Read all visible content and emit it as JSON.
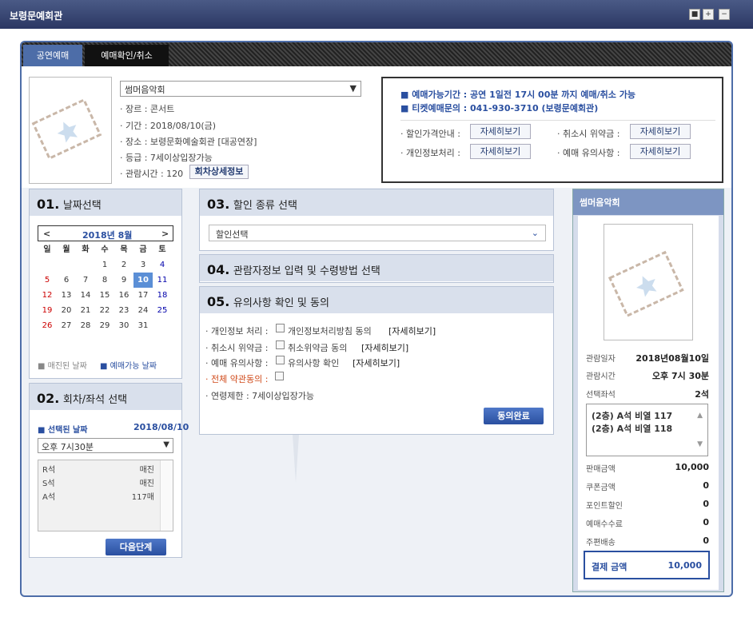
{
  "window": {
    "title": "보령문예회관",
    "buttons": [
      "■",
      "+",
      "−"
    ]
  },
  "tabs": [
    "공연예매",
    "예매확인/취소"
  ],
  "show": {
    "selected": "썸머음악회",
    "genre": "· 장르 : 콘서트",
    "period": "· 기간 : 2018/08/10(금)",
    "venue": "· 장소 : 보령문화예술회관 [대공연장]",
    "grade": "· 등급 : 7세이상입장가능",
    "runtime": "· 관람시간 : 120",
    "detail_btn": "회차상세정보"
  },
  "notice": {
    "line1": "■ 예매가능기간 : 공연 1일전 17시 00분 까지 예매/취소 가능",
    "line2": "■ 티켓예매문의 : 041-930-3710 (보령문예회관)",
    "r1l": "· 할인가격안내 :",
    "r1r": "· 취소시 위약금 :",
    "r2l": "· 개인정보처리 :",
    "r2r": "· 예매 유의사항 :",
    "btn": "자세히보기"
  },
  "p1": {
    "num": "01.",
    "title": "날짜선택",
    "month": "2018년 8월",
    "prev": "<",
    "next": ">",
    "days": [
      "일",
      "월",
      "화",
      "수",
      "목",
      "금",
      "토"
    ],
    "weeks": [
      [
        "",
        "",
        "",
        "1",
        "2",
        "3",
        "4"
      ],
      [
        "5",
        "6",
        "7",
        "8",
        "9",
        "10",
        "11"
      ],
      [
        "12",
        "13",
        "14",
        "15",
        "16",
        "17",
        "18"
      ],
      [
        "19",
        "20",
        "21",
        "22",
        "23",
        "24",
        "25"
      ],
      [
        "26",
        "27",
        "28",
        "29",
        "30",
        "31",
        ""
      ]
    ],
    "leg1": "■ 매진된 날짜",
    "leg2": "■ 예매가능 날짜"
  },
  "p2": {
    "num": "02.",
    "title": "회차/좌석 선택",
    "sel_label": "■ 선택된 날짜",
    "sel_date": "2018/08/10",
    "time": "오후 7시30분",
    "seats": [
      [
        "R석",
        "매진"
      ],
      [
        "S석",
        "매진"
      ],
      [
        "A석",
        "117매"
      ]
    ],
    "next": "다음단계"
  },
  "p3": {
    "num": "03.",
    "title": "할인 종류 선택",
    "select": "할인선택"
  },
  "p4": {
    "num": "04.",
    "title": "관람자정보 입력 및 수령방법 선택"
  },
  "p5": {
    "num": "05.",
    "title": "유의사항 확인 및 동의",
    "l1": "· 개인정보 처리 :",
    "l1b": "개인정보처리방침 동의",
    "l2": "· 취소시 위약금 :",
    "l2b": "취소위약금 동의",
    "l3": "· 예매 유의사항 :",
    "l3b": "유의사항 확인",
    "detail": "[자세히보기]",
    "l4": "· 전체 약관동의 :",
    "l5": "· 연령제한 : 7세이상입장가능",
    "agree": "동의완료"
  },
  "summary": {
    "title": "썸머음악회",
    "date_l": "관람일자",
    "date_v": "2018년08월10일",
    "time_l": "관람시간",
    "time_v": "오후 7시 30분",
    "seat_l": "선택좌석",
    "seat_v": "2석",
    "seats": [
      "(2층) A석 비열 117",
      "(2층) A석 비열 118"
    ],
    "sale_l": "판매금액",
    "sale_v": "10,000",
    "coupon_l": "쿠폰금액",
    "coupon_v": "0",
    "point_l": "포인트할인",
    "point_v": "0",
    "fee_l": "예매수수료",
    "fee_v": "0",
    "ship_l": "주편배송",
    "ship_v": "0",
    "pay_l": "결제 금액",
    "pay_v": "10,000"
  }
}
